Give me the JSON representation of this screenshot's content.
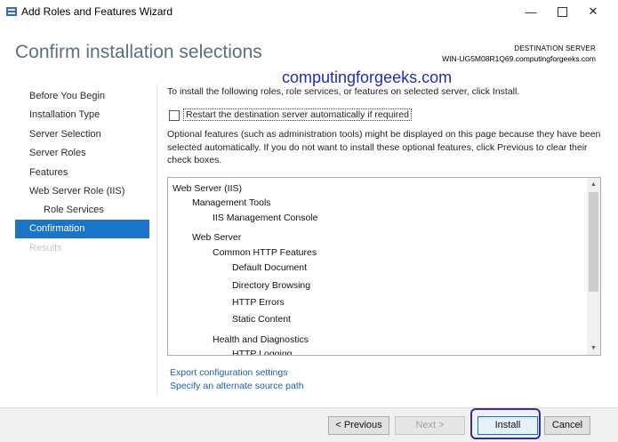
{
  "window": {
    "title": "Add Roles and Features Wizard",
    "controls": {
      "minimize": "—",
      "close": "✕"
    }
  },
  "header": {
    "page_title": "Confirm installation selections",
    "destination_label": "DESTINATION SERVER",
    "destination_value": "WIN-UG5M08R1Q69.computingforgeeks.com",
    "watermark": "computingforgeeks.com"
  },
  "nav": {
    "items": [
      {
        "label": "Before You Begin"
      },
      {
        "label": "Installation Type"
      },
      {
        "label": "Server Selection"
      },
      {
        "label": "Server Roles"
      },
      {
        "label": "Features"
      },
      {
        "label": "Web Server Role (IIS)"
      },
      {
        "label": "Role Services"
      },
      {
        "label": "Confirmation"
      },
      {
        "label": "Results"
      }
    ],
    "active": "Confirmation"
  },
  "content": {
    "intro": "To install the following roles, role services, or features on selected server, click Install.",
    "restart_checkbox": {
      "label": "Restart the destination server automatically if required",
      "checked": false
    },
    "optional_text": "Optional features (such as administration tools) might be displayed on this page because they have been selected automatically. If you do not want to install these optional features, click Previous to clear their check boxes.",
    "tree": [
      {
        "label": "Web Server (IIS)"
      },
      {
        "label": "Management Tools"
      },
      {
        "label": "IIS Management Console"
      },
      {
        "label": "Web Server"
      },
      {
        "label": "Common HTTP Features"
      },
      {
        "label": "Default Document"
      },
      {
        "label": "Directory Browsing"
      },
      {
        "label": "HTTP Errors"
      },
      {
        "label": "Static Content"
      },
      {
        "label": "Health and Diagnostics"
      },
      {
        "label": "HTTP Logging"
      }
    ],
    "links": {
      "export": "Export configuration settings",
      "alternate_source": "Specify an alternate source path"
    }
  },
  "footer": {
    "previous": "< Previous",
    "next": "Next >",
    "install": "Install",
    "cancel": "Cancel"
  },
  "colors": {
    "accent": "#1a74c9",
    "title": "#5a7082",
    "link": "#1a5fb4",
    "watermark": "#1f2db8"
  }
}
